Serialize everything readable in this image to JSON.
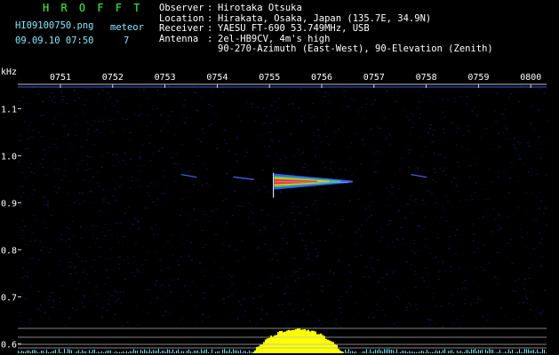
{
  "header": {
    "brand": "H R O F F T",
    "filename": "HI09100750.png",
    "timestamp": "09.09.10 07:50",
    "meteor_label": "meteor",
    "meteor_count": "7",
    "info": [
      {
        "key": "Observer",
        "sep": ":",
        "value": "Hirotaka Otsuka"
      },
      {
        "key": "Location",
        "sep": ":",
        "value": "Hirakata, Osaka, Japan (135.7E, 34.9N)"
      },
      {
        "key": "Receiver",
        "sep": ":",
        "value": "YAESU FT-690 53.749MHz, USB"
      },
      {
        "key": "Antenna",
        "sep": ":",
        "value": "2el-HB9CV, 4m's high"
      },
      {
        "key": "",
        "sep": "",
        "value": "90-270-Azimuth (East-West), 90-Elevation (Zenith)"
      }
    ]
  },
  "chart_data": {
    "type": "heatmap",
    "ylabel": "kHz",
    "x_ticks": [
      "0751",
      "0752",
      "0753",
      "0754",
      "0755",
      "0756",
      "0757",
      "0758",
      "0759",
      "0800"
    ],
    "y_ticks": [
      "1.1",
      "1.0",
      "0.9",
      "0.8",
      "0.7",
      "0.6"
    ],
    "ylim": [
      0.58,
      1.15
    ],
    "xlim_minutes": [
      0,
      10
    ],
    "events": [
      {
        "type": "meteor_echo",
        "start_min": 4.5,
        "end_min": 6.0,
        "freq_khz": 0.945,
        "intensity": "strong"
      },
      {
        "type": "faint_trace",
        "start_min": 2.8,
        "end_min": 3.1,
        "freq_khz": 0.96,
        "intensity": "weak"
      },
      {
        "type": "faint_trace",
        "start_min": 3.8,
        "end_min": 4.2,
        "freq_khz": 0.955,
        "intensity": "weak"
      },
      {
        "type": "faint_trace",
        "start_min": 7.2,
        "end_min": 7.5,
        "freq_khz": 0.96,
        "intensity": "weak"
      }
    ],
    "colors": {
      "background": "#000000",
      "noise": "#0b1a4a",
      "hot": "#ff2020",
      "warm": "#ffd000",
      "cool": "#3a6bff",
      "histogram": "#ffff00",
      "histogram_low": "#6fe6ff"
    }
  }
}
